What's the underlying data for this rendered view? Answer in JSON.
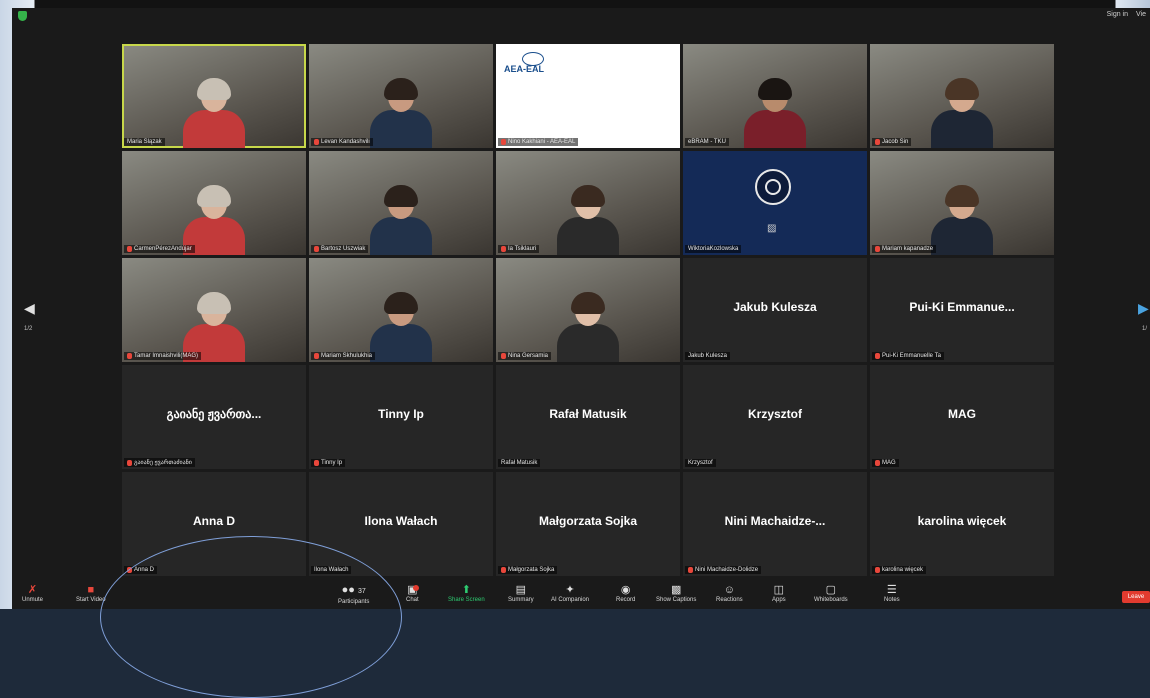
{
  "top_right": {
    "sign_in": "Sign in",
    "view": "Vie"
  },
  "pager": {
    "left_page": "1/2",
    "right_page": "1/"
  },
  "tiles": [
    {
      "name": "Maria Ślązak",
      "type": "video",
      "speaker": true,
      "muted": false
    },
    {
      "name": "Levan Kandashvili",
      "type": "video",
      "muted": true
    },
    {
      "name": "Nino Kakhiani - AEA-EAL",
      "type": "logo",
      "logo_text": "AEA-EAL",
      "muted": true
    },
    {
      "name": "eBRAM - TKU",
      "type": "video",
      "muted": false
    },
    {
      "name": "Jacob Sin",
      "type": "video",
      "muted": true
    },
    {
      "name": "CarmenPérezAndújar",
      "type": "video",
      "muted": true
    },
    {
      "name": "Bartosz Uszwiak",
      "type": "video",
      "muted": true
    },
    {
      "name": "Ia Tsiklauri",
      "type": "video",
      "muted": true
    },
    {
      "name": "WiktoriaKozlowska",
      "type": "obs",
      "muted": false
    },
    {
      "name": "Mariam kapanadze",
      "type": "video",
      "muted": true
    },
    {
      "name": "Tamar Imnaishvili(MAG)",
      "type": "video",
      "muted": true
    },
    {
      "name": "Mariam Skhulukhia",
      "type": "video",
      "muted": true
    },
    {
      "name": "Nina Gersamia",
      "type": "video",
      "muted": true
    },
    {
      "name": "Jakub Kulesza",
      "display": "Jakub Kulesza",
      "type": "name",
      "muted": false
    },
    {
      "name": "Pui-Ki Emmanuelle Ta",
      "display": "Pui-Ki  Emmanue...",
      "type": "name",
      "muted": true
    },
    {
      "name": "გაიანე ჟვართაძიანი",
      "display": "გაიანე ჟვართა...",
      "type": "name",
      "muted": true
    },
    {
      "name": "Tinny Ip",
      "display": "Tinny Ip",
      "type": "name",
      "muted": true
    },
    {
      "name": "Rafał Matusik",
      "display": "Rafał Matusik",
      "type": "name",
      "muted": false
    },
    {
      "name": "Krzysztof",
      "display": "Krzysztof",
      "type": "name",
      "muted": false
    },
    {
      "name": "MAG",
      "display": "MAG",
      "type": "name",
      "muted": true
    },
    {
      "name": "Anna D",
      "display": "Anna D",
      "type": "name",
      "muted": true
    },
    {
      "name": "Ilona Wałach",
      "display": "Ilona Wałach",
      "type": "name",
      "muted": false
    },
    {
      "name": "Małgorzata Sojka",
      "display": "Małgorzata Sojka",
      "type": "name",
      "muted": true
    },
    {
      "name": "Nini Machaidze-Dolidze",
      "display": "Nini  Machaidze-...",
      "type": "name",
      "muted": true
    },
    {
      "name": "karolina więcek",
      "display": "karolina więcek",
      "type": "name",
      "muted": true
    }
  ],
  "toolbar": {
    "unmute": "Unmute",
    "start_video": "Start Video",
    "participants": "Participants",
    "participants_count": "37",
    "chat": "Chat",
    "share_screen": "Share Screen",
    "summary": "Summary",
    "ai_companion": "AI Companion",
    "record": "Record",
    "show_captions": "Show Captions",
    "reactions": "Reactions",
    "apps": "Apps",
    "whiteboards": "Whiteboards",
    "notes": "Notes",
    "leave": "Leave"
  },
  "colors": {
    "speaker_outline": "#c7d74a",
    "share_green": "#2ecc71",
    "leave_red": "#e23b2f",
    "muted_red": "#e8473b"
  }
}
